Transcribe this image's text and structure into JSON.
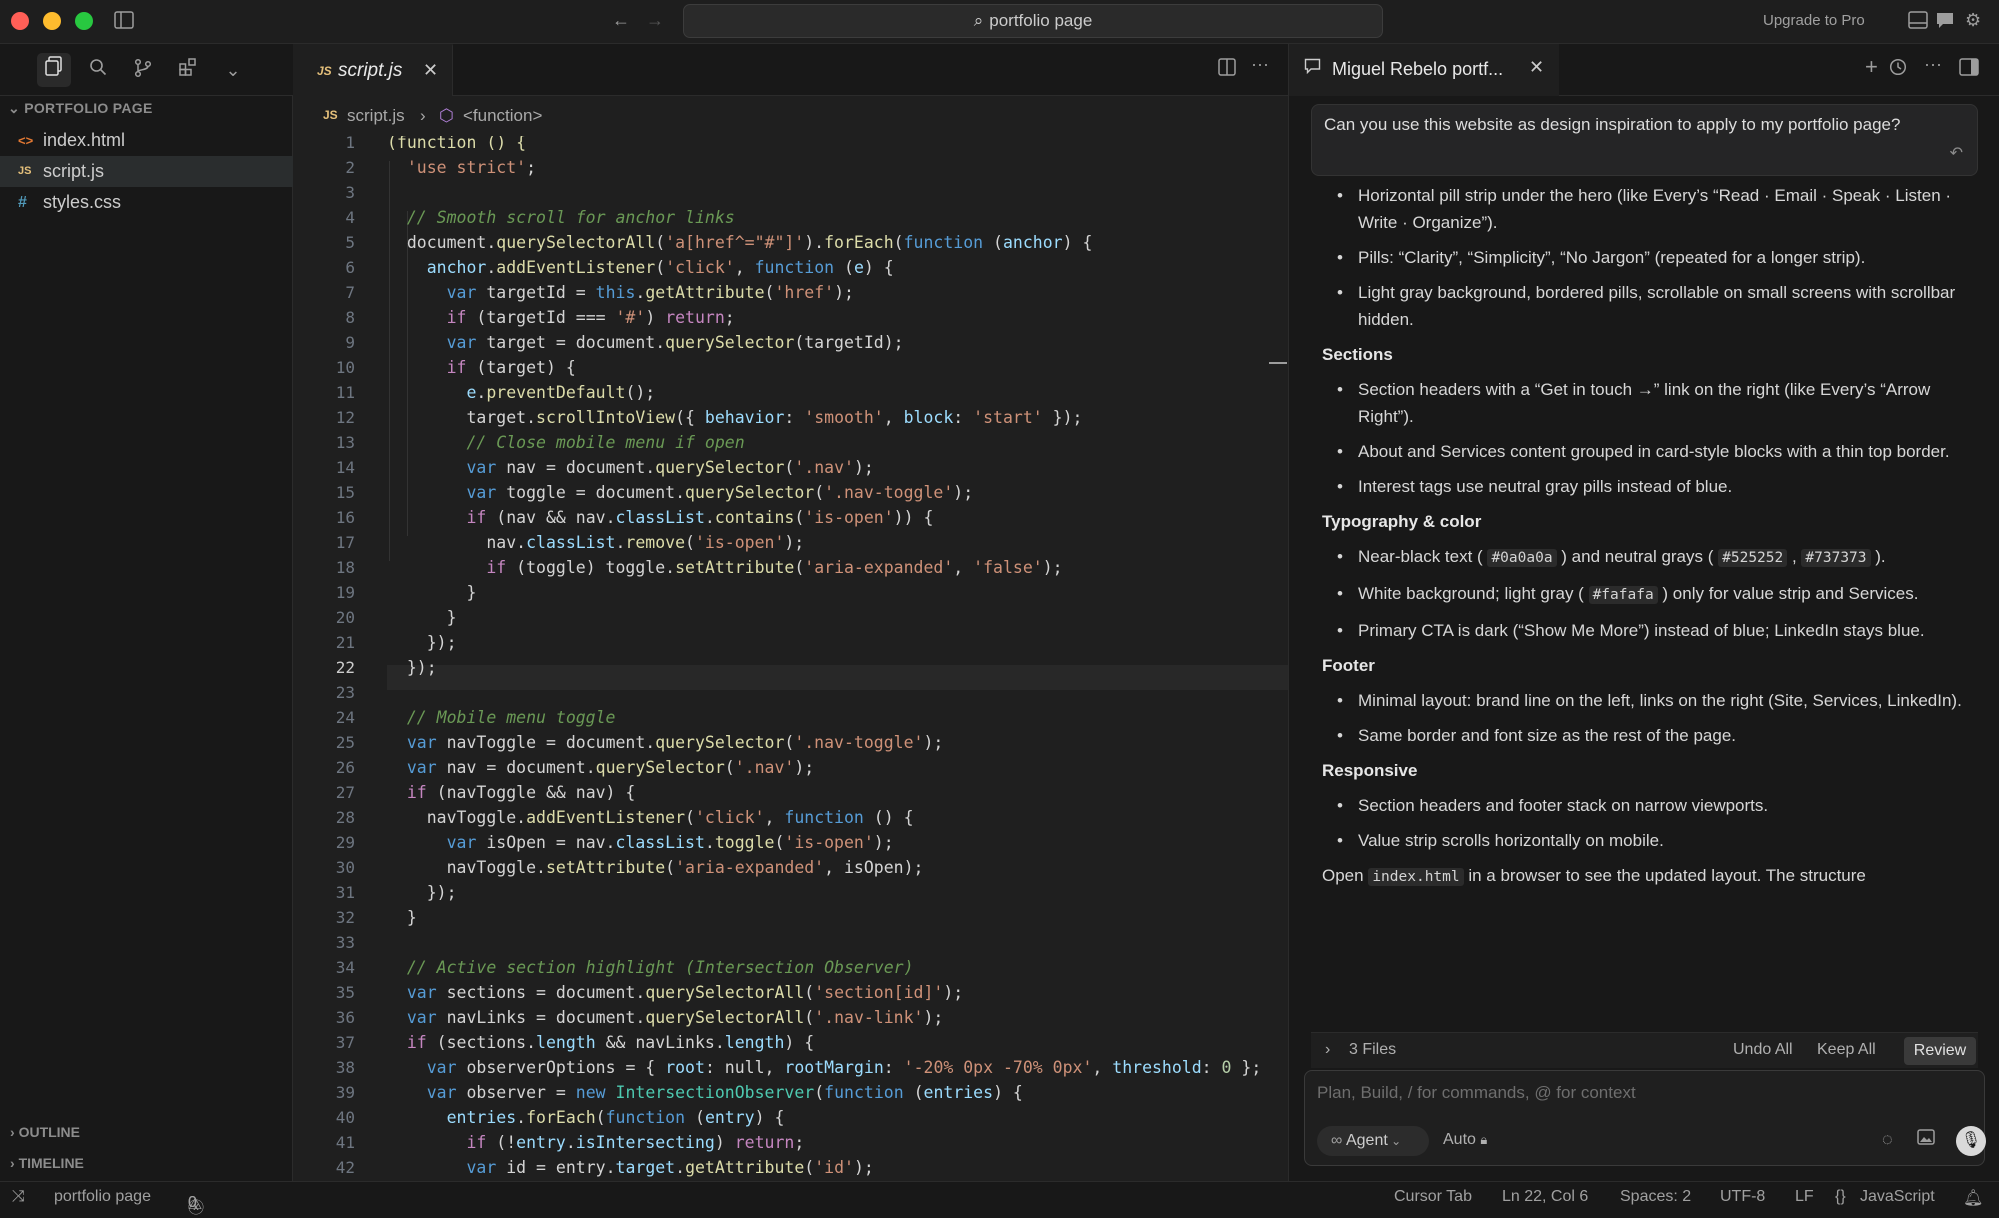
{
  "titlebar": {
    "search_text": "portfolio page",
    "upgrade_label": "Upgrade to Pro"
  },
  "sidebar": {
    "section_title": "PORTFOLIO PAGE",
    "files": [
      {
        "name": "index.html",
        "icon": "<>",
        "color": "#e37933"
      },
      {
        "name": "script.js",
        "icon": "JS",
        "color": "#e5c07b"
      },
      {
        "name": "styles.css",
        "icon": "#",
        "color": "#519aba"
      }
    ],
    "outline_label": "OUTLINE",
    "timeline_label": "TIMELINE"
  },
  "editor": {
    "tab_label": "script.js",
    "tab_icon": "JS",
    "breadcrumb": {
      "file": "script.js",
      "symbol": "<function>"
    },
    "current_line": 22,
    "lines": [
      [
        [
          "(function () {",
          "#dcdcaa"
        ]
      ],
      [
        [
          "  ",
          "#d4d4d4"
        ],
        [
          "'use strict'",
          "#ce9178"
        ],
        [
          ";",
          "#d4d4d4"
        ]
      ],
      [],
      [
        [
          "  ",
          "#d4d4d4"
        ],
        [
          "// Smooth scroll for anchor links",
          "#6a9955"
        ]
      ],
      [
        [
          "  document.",
          "#d4d4d4"
        ],
        [
          "querySelectorAll",
          "#dcdcaa"
        ],
        [
          "(",
          "#d4d4d4"
        ],
        [
          "'a[href^=\"#\"]'",
          "#ce9178"
        ],
        [
          ").",
          "#d4d4d4"
        ],
        [
          "forEach",
          "#dcdcaa"
        ],
        [
          "(",
          "#d4d4d4"
        ],
        [
          "function",
          "#569cd6"
        ],
        [
          " (",
          "#d4d4d4"
        ],
        [
          "anchor",
          "#9cdcfe"
        ],
        [
          ") {",
          "#d4d4d4"
        ]
      ],
      [
        [
          "    ",
          "#d4d4d4"
        ],
        [
          "anchor",
          "#9cdcfe"
        ],
        [
          ".",
          "#d4d4d4"
        ],
        [
          "addEventListener",
          "#dcdcaa"
        ],
        [
          "(",
          "#d4d4d4"
        ],
        [
          "'click'",
          "#ce9178"
        ],
        [
          ", ",
          "#d4d4d4"
        ],
        [
          "function",
          "#569cd6"
        ],
        [
          " (",
          "#d4d4d4"
        ],
        [
          "e",
          "#9cdcfe"
        ],
        [
          ") {",
          "#d4d4d4"
        ]
      ],
      [
        [
          "      ",
          "#d4d4d4"
        ],
        [
          "var",
          "#569cd6"
        ],
        [
          " targetId = ",
          "#d4d4d4"
        ],
        [
          "this",
          "#569cd6"
        ],
        [
          ".",
          "#d4d4d4"
        ],
        [
          "getAttribute",
          "#dcdcaa"
        ],
        [
          "(",
          "#d4d4d4"
        ],
        [
          "'href'",
          "#ce9178"
        ],
        [
          ");",
          "#d4d4d4"
        ]
      ],
      [
        [
          "      ",
          "#d4d4d4"
        ],
        [
          "if",
          "#c586c0"
        ],
        [
          " (targetId === ",
          "#d4d4d4"
        ],
        [
          "'#'",
          "#ce9178"
        ],
        [
          ") ",
          "#d4d4d4"
        ],
        [
          "return",
          "#c586c0"
        ],
        [
          ";",
          "#d4d4d4"
        ]
      ],
      [
        [
          "      ",
          "#d4d4d4"
        ],
        [
          "var",
          "#569cd6"
        ],
        [
          " target = document.",
          "#d4d4d4"
        ],
        [
          "querySelector",
          "#dcdcaa"
        ],
        [
          "(targetId);",
          "#d4d4d4"
        ]
      ],
      [
        [
          "      ",
          "#d4d4d4"
        ],
        [
          "if",
          "#c586c0"
        ],
        [
          " (target) {",
          "#d4d4d4"
        ]
      ],
      [
        [
          "        ",
          "#d4d4d4"
        ],
        [
          "e",
          "#9cdcfe"
        ],
        [
          ".",
          "#d4d4d4"
        ],
        [
          "preventDefault",
          "#dcdcaa"
        ],
        [
          "();",
          "#d4d4d4"
        ]
      ],
      [
        [
          "        target.",
          "#d4d4d4"
        ],
        [
          "scrollIntoView",
          "#dcdcaa"
        ],
        [
          "({ ",
          "#d4d4d4"
        ],
        [
          "behavior",
          "#9cdcfe"
        ],
        [
          ": ",
          "#d4d4d4"
        ],
        [
          "'smooth'",
          "#ce9178"
        ],
        [
          ", ",
          "#d4d4d4"
        ],
        [
          "block",
          "#9cdcfe"
        ],
        [
          ": ",
          "#d4d4d4"
        ],
        [
          "'start'",
          "#ce9178"
        ],
        [
          " });",
          "#d4d4d4"
        ]
      ],
      [
        [
          "        ",
          "#d4d4d4"
        ],
        [
          "// Close mobile menu if open",
          "#6a9955"
        ]
      ],
      [
        [
          "        ",
          "#d4d4d4"
        ],
        [
          "var",
          "#569cd6"
        ],
        [
          " nav = document.",
          "#d4d4d4"
        ],
        [
          "querySelector",
          "#dcdcaa"
        ],
        [
          "(",
          "#d4d4d4"
        ],
        [
          "'.nav'",
          "#ce9178"
        ],
        [
          ");",
          "#d4d4d4"
        ]
      ],
      [
        [
          "        ",
          "#d4d4d4"
        ],
        [
          "var",
          "#569cd6"
        ],
        [
          " toggle = document.",
          "#d4d4d4"
        ],
        [
          "querySelector",
          "#dcdcaa"
        ],
        [
          "(",
          "#d4d4d4"
        ],
        [
          "'.nav-toggle'",
          "#ce9178"
        ],
        [
          ");",
          "#d4d4d4"
        ]
      ],
      [
        [
          "        ",
          "#d4d4d4"
        ],
        [
          "if",
          "#c586c0"
        ],
        [
          " (nav && nav.",
          "#d4d4d4"
        ],
        [
          "classList",
          "#9cdcfe"
        ],
        [
          ".",
          "#d4d4d4"
        ],
        [
          "contains",
          "#dcdcaa"
        ],
        [
          "(",
          "#d4d4d4"
        ],
        [
          "'is-open'",
          "#ce9178"
        ],
        [
          ")) {",
          "#d4d4d4"
        ]
      ],
      [
        [
          "          nav.",
          "#d4d4d4"
        ],
        [
          "classList",
          "#9cdcfe"
        ],
        [
          ".",
          "#d4d4d4"
        ],
        [
          "remove",
          "#dcdcaa"
        ],
        [
          "(",
          "#d4d4d4"
        ],
        [
          "'is-open'",
          "#ce9178"
        ],
        [
          ");",
          "#d4d4d4"
        ]
      ],
      [
        [
          "          ",
          "#d4d4d4"
        ],
        [
          "if",
          "#c586c0"
        ],
        [
          " (toggle) toggle.",
          "#d4d4d4"
        ],
        [
          "setAttribute",
          "#dcdcaa"
        ],
        [
          "(",
          "#d4d4d4"
        ],
        [
          "'aria-expanded'",
          "#ce9178"
        ],
        [
          ", ",
          "#d4d4d4"
        ],
        [
          "'false'",
          "#ce9178"
        ],
        [
          ");",
          "#d4d4d4"
        ]
      ],
      [
        [
          "        }",
          "#d4d4d4"
        ]
      ],
      [
        [
          "      }",
          "#d4d4d4"
        ]
      ],
      [
        [
          "    });",
          "#d4d4d4"
        ]
      ],
      [
        [
          "  });",
          "#d4d4d4"
        ]
      ],
      [],
      [
        [
          "  ",
          "#d4d4d4"
        ],
        [
          "// Mobile menu toggle",
          "#6a9955"
        ]
      ],
      [
        [
          "  ",
          "#d4d4d4"
        ],
        [
          "var",
          "#569cd6"
        ],
        [
          " navToggle = document.",
          "#d4d4d4"
        ],
        [
          "querySelector",
          "#dcdcaa"
        ],
        [
          "(",
          "#d4d4d4"
        ],
        [
          "'.nav-toggle'",
          "#ce9178"
        ],
        [
          ");",
          "#d4d4d4"
        ]
      ],
      [
        [
          "  ",
          "#d4d4d4"
        ],
        [
          "var",
          "#569cd6"
        ],
        [
          " nav = document.",
          "#d4d4d4"
        ],
        [
          "querySelector",
          "#dcdcaa"
        ],
        [
          "(",
          "#d4d4d4"
        ],
        [
          "'.nav'",
          "#ce9178"
        ],
        [
          ");",
          "#d4d4d4"
        ]
      ],
      [
        [
          "  ",
          "#d4d4d4"
        ],
        [
          "if",
          "#c586c0"
        ],
        [
          " (navToggle && nav) {",
          "#d4d4d4"
        ]
      ],
      [
        [
          "    navToggle.",
          "#d4d4d4"
        ],
        [
          "addEventListener",
          "#dcdcaa"
        ],
        [
          "(",
          "#d4d4d4"
        ],
        [
          "'click'",
          "#ce9178"
        ],
        [
          ", ",
          "#d4d4d4"
        ],
        [
          "function",
          "#569cd6"
        ],
        [
          " () {",
          "#d4d4d4"
        ]
      ],
      [
        [
          "      ",
          "#d4d4d4"
        ],
        [
          "var",
          "#569cd6"
        ],
        [
          " isOpen = nav.",
          "#d4d4d4"
        ],
        [
          "classList",
          "#9cdcfe"
        ],
        [
          ".",
          "#d4d4d4"
        ],
        [
          "toggle",
          "#dcdcaa"
        ],
        [
          "(",
          "#d4d4d4"
        ],
        [
          "'is-open'",
          "#ce9178"
        ],
        [
          ");",
          "#d4d4d4"
        ]
      ],
      [
        [
          "      navToggle.",
          "#d4d4d4"
        ],
        [
          "setAttribute",
          "#dcdcaa"
        ],
        [
          "(",
          "#d4d4d4"
        ],
        [
          "'aria-expanded'",
          "#ce9178"
        ],
        [
          ", isOpen);",
          "#d4d4d4"
        ]
      ],
      [
        [
          "    });",
          "#d4d4d4"
        ]
      ],
      [
        [
          "  }",
          "#d4d4d4"
        ]
      ],
      [],
      [
        [
          "  ",
          "#d4d4d4"
        ],
        [
          "// Active section highlight (Intersection Observer)",
          "#6a9955"
        ]
      ],
      [
        [
          "  ",
          "#d4d4d4"
        ],
        [
          "var",
          "#569cd6"
        ],
        [
          " sections = document.",
          "#d4d4d4"
        ],
        [
          "querySelectorAll",
          "#dcdcaa"
        ],
        [
          "(",
          "#d4d4d4"
        ],
        [
          "'section[id]'",
          "#ce9178"
        ],
        [
          ");",
          "#d4d4d4"
        ]
      ],
      [
        [
          "  ",
          "#d4d4d4"
        ],
        [
          "var",
          "#569cd6"
        ],
        [
          " navLinks = document.",
          "#d4d4d4"
        ],
        [
          "querySelectorAll",
          "#dcdcaa"
        ],
        [
          "(",
          "#d4d4d4"
        ],
        [
          "'.nav-link'",
          "#ce9178"
        ],
        [
          ");",
          "#d4d4d4"
        ]
      ],
      [
        [
          "  ",
          "#d4d4d4"
        ],
        [
          "if",
          "#c586c0"
        ],
        [
          " (sections.",
          "#d4d4d4"
        ],
        [
          "length",
          "#9cdcfe"
        ],
        [
          " && navLinks.",
          "#d4d4d4"
        ],
        [
          "length",
          "#9cdcfe"
        ],
        [
          ") {",
          "#d4d4d4"
        ]
      ],
      [
        [
          "    ",
          "#d4d4d4"
        ],
        [
          "var",
          "#569cd6"
        ],
        [
          " observerOptions = { ",
          "#d4d4d4"
        ],
        [
          "root",
          "#9cdcfe"
        ],
        [
          ": null, ",
          "#d4d4d4"
        ],
        [
          "rootMargin",
          "#9cdcfe"
        ],
        [
          ": ",
          "#d4d4d4"
        ],
        [
          "'-20% 0px -70% 0px'",
          "#ce9178"
        ],
        [
          ", ",
          "#d4d4d4"
        ],
        [
          "threshold",
          "#9cdcfe"
        ],
        [
          ": ",
          "#d4d4d4"
        ],
        [
          "0",
          "#b5cea8"
        ],
        [
          " };",
          "#d4d4d4"
        ]
      ],
      [
        [
          "    ",
          "#d4d4d4"
        ],
        [
          "var",
          "#569cd6"
        ],
        [
          " observer = ",
          "#d4d4d4"
        ],
        [
          "new",
          "#569cd6"
        ],
        [
          " ",
          "#d4d4d4"
        ],
        [
          "IntersectionObserver",
          "#4ec9b0"
        ],
        [
          "(",
          "#d4d4d4"
        ],
        [
          "function",
          "#569cd6"
        ],
        [
          " (",
          "#d4d4d4"
        ],
        [
          "entries",
          "#9cdcfe"
        ],
        [
          ") {",
          "#d4d4d4"
        ]
      ],
      [
        [
          "      ",
          "#d4d4d4"
        ],
        [
          "entries",
          "#9cdcfe"
        ],
        [
          ".",
          "#d4d4d4"
        ],
        [
          "forEach",
          "#dcdcaa"
        ],
        [
          "(",
          "#d4d4d4"
        ],
        [
          "function",
          "#569cd6"
        ],
        [
          " (",
          "#d4d4d4"
        ],
        [
          "entry",
          "#9cdcfe"
        ],
        [
          ") {",
          "#d4d4d4"
        ]
      ],
      [
        [
          "        ",
          "#d4d4d4"
        ],
        [
          "if",
          "#c586c0"
        ],
        [
          " (!",
          "#d4d4d4"
        ],
        [
          "entry",
          "#9cdcfe"
        ],
        [
          ".",
          "#d4d4d4"
        ],
        [
          "isIntersecting",
          "#9cdcfe"
        ],
        [
          ") ",
          "#d4d4d4"
        ],
        [
          "return",
          "#c586c0"
        ],
        [
          ";",
          "#d4d4d4"
        ]
      ],
      [
        [
          "        ",
          "#d4d4d4"
        ],
        [
          "var",
          "#569cd6"
        ],
        [
          " id = entry.",
          "#d4d4d4"
        ],
        [
          "target",
          "#9cdcfe"
        ],
        [
          ".",
          "#d4d4d4"
        ],
        [
          "getAttribute",
          "#dcdcaa"
        ],
        [
          "(",
          "#d4d4d4"
        ],
        [
          "'id'",
          "#ce9178"
        ],
        [
          ");",
          "#d4d4d4"
        ]
      ]
    ]
  },
  "chat": {
    "tab_title": "Miguel Rebelo portf...",
    "user_message": "Can you use this website as design inspiration to apply to my portfolio page?",
    "blocks": [
      {
        "type": "li",
        "html": "Horizontal pill strip under the hero (like Every’s “Read · Email · Speak · Listen · Write · Organize”)."
      },
      {
        "type": "li",
        "html": "Pills: “Clarity”, “Simplicity”, “No Jargon” (repeated for a longer strip)."
      },
      {
        "type": "li",
        "html": "Light gray background, bordered pills, scrollable on small screens with scrollbar hidden."
      },
      {
        "type": "h",
        "html": "Sections"
      },
      {
        "type": "li",
        "html": "Section headers with a “Get in touch →” link on the right (like Every’s “Arrow Right”)."
      },
      {
        "type": "li",
        "html": "About and Services content grouped in card-style blocks with a thin top border."
      },
      {
        "type": "li",
        "html": "Interest tags use neutral gray pills instead of blue."
      },
      {
        "type": "h",
        "html": "Typography & color"
      },
      {
        "type": "li",
        "html": "Near-black text ( <code>#0a0a0a</code> ) and neutral grays ( <code>#525252</code> , <code>#737373</code> )."
      },
      {
        "type": "li",
        "html": "White background; light gray ( <code>#fafafa</code> ) only for value strip and Services."
      },
      {
        "type": "li",
        "html": "Primary CTA is dark (“Show Me More”) instead of blue; LinkedIn stays blue."
      },
      {
        "type": "h",
        "html": "Footer"
      },
      {
        "type": "li",
        "html": "Minimal layout: brand line on the left, links on the right (Site, Services, LinkedIn)."
      },
      {
        "type": "li",
        "html": "Same border and font size as the rest of the page."
      },
      {
        "type": "h",
        "html": "Responsive"
      },
      {
        "type": "li",
        "html": "Section headers and footer stack on narrow viewports."
      },
      {
        "type": "li",
        "html": "Value strip scrolls horizontally on mobile."
      },
      {
        "type": "p",
        "html": "Open <code>index.html</code> in a browser to see the updated layout. The structure"
      }
    ],
    "files_label": "3 Files",
    "undo_all": "Undo All",
    "keep_all": "Keep All",
    "review": "Review",
    "input_placeholder": "Plan, Build, / for commands, @ for context",
    "agent_label": "Agent",
    "auto_label": "Auto"
  },
  "statusbar": {
    "project": "portfolio page",
    "errors": "0",
    "warnings": "0",
    "cursor_tab": "Cursor Tab",
    "position": "Ln 22, Col 6",
    "spaces": "Spaces: 2",
    "encoding": "UTF-8",
    "eol": "LF",
    "language": "JavaScript"
  }
}
